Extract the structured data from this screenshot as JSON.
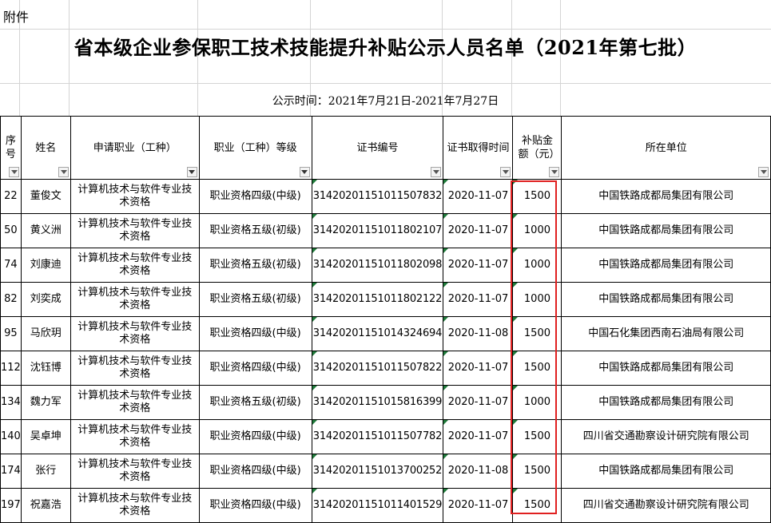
{
  "sheet": {
    "attachment_label": "附件",
    "title": "省本级企业参保职工技术技能提升补贴公示人员名单（2021年第七批）",
    "notice": "公示时间：2021年7月21日-2021年7月27日"
  },
  "headers": {
    "seq": "序号",
    "name": "姓名",
    "job": "申请职业（工种）",
    "level": "职业（工种）等级",
    "cert": "证书编号",
    "date": "证书取得时间",
    "amount": "补贴金额（元）",
    "company": "所在单位"
  },
  "rows": [
    {
      "seq": "22",
      "name": "董俊文",
      "job": "计算机技术与软件专业技术资格",
      "level": "职业资格四级(中级)",
      "cert": "3142020115101150783​2",
      "date": "2020-11-07",
      "amount": "1500",
      "company": "中国铁路成都局集团有限公司"
    },
    {
      "seq": "50",
      "name": "黄义洲",
      "job": "计算机技术与软件专业技术资格",
      "level": "职业资格五级(初级)",
      "cert": "31420201151011802107",
      "date": "2020-11-07",
      "amount": "1000",
      "company": "中国铁路成都局集团有限公司"
    },
    {
      "seq": "74",
      "name": "刘康迪",
      "job": "计算机技术与软件专业技术资格",
      "level": "职业资格五级(初级)",
      "cert": "31420201151011802098",
      "date": "2020-11-07",
      "amount": "1000",
      "company": "中国铁路成都局集团有限公司"
    },
    {
      "seq": "82",
      "name": "刘奕成",
      "job": "计算机技术与软件专业技术资格",
      "level": "职业资格五级(初级)",
      "cert": "31420201151011802122",
      "date": "2020-11-07",
      "amount": "1000",
      "company": "中国铁路成都局集团有限公司"
    },
    {
      "seq": "95",
      "name": "马欣玥",
      "job": "计算机技术与软件专业技术资格",
      "level": "职业资格四级(中级)",
      "cert": "31420201151014324694",
      "date": "2020-11-08",
      "amount": "1500",
      "company": "中国石化集团西南石油局有限公司"
    },
    {
      "seq": "112",
      "name": "沈钰博",
      "job": "计算机技术与软件专业技术资格",
      "level": "职业资格四级(中级)",
      "cert": "31420201151011507822",
      "date": "2020-11-07",
      "amount": "1500",
      "company": "中国铁路成都局集团有限公司"
    },
    {
      "seq": "134",
      "name": "魏力军",
      "job": "计算机技术与软件专业技术资格",
      "level": "职业资格五级(初级)",
      "cert": "31420201151015816399",
      "date": "2020-11-07",
      "amount": "1000",
      "company": "中国铁路成都局集团有限公司"
    },
    {
      "seq": "140",
      "name": "吴卓坤",
      "job": "计算机技术与软件专业技术资格",
      "level": "职业资格四级(中级)",
      "cert": "31420201151011507782",
      "date": "2020-11-07",
      "amount": "1500",
      "company": "四川省交通勘察设计研究院有限公司"
    },
    {
      "seq": "174",
      "name": "张行",
      "job": "计算机技术与软件专业技术资格",
      "level": "职业资格四级(中级)",
      "cert": "31420201151013700252",
      "date": "2020-11-08",
      "amount": "1500",
      "company": "中国铁路成都局集团有限公司"
    },
    {
      "seq": "197",
      "name": "祝嘉浩",
      "job": "计算机技术与软件专业技术资格",
      "level": "职业资格四级(中级)",
      "cert": "31420201151011401529",
      "date": "2020-11-07",
      "amount": "1500",
      "company": "四川省交通勘察设计研究院有限公司"
    }
  ],
  "colors": {
    "highlight": "#e02020",
    "gridline": "#d4d4d4",
    "comment_marker": "#1f7a3a"
  },
  "icons": {
    "filter": "dropdown-filter-icon",
    "active_filter": "funnel-filter-icon",
    "cell_marker": "green-triangle-icon"
  }
}
